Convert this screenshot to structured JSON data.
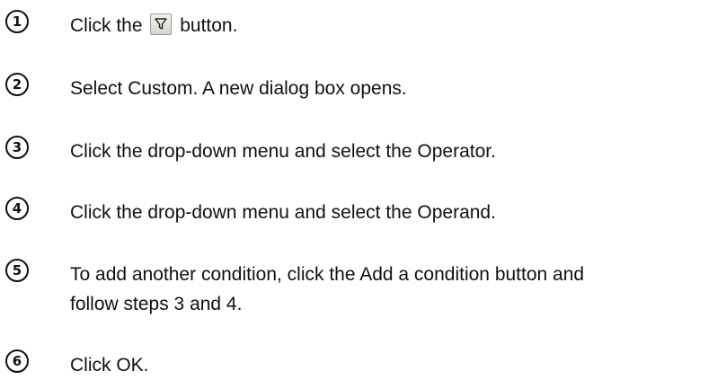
{
  "steps": [
    {
      "number": "1",
      "before": "Click the",
      "icon": "filter-icon",
      "after": "button."
    },
    {
      "number": "2",
      "text": "Select Custom. A new dialog box opens."
    },
    {
      "number": "3",
      "text": "Click the drop-down menu and select the Operator."
    },
    {
      "number": "4",
      "text": "Click the drop-down menu and select the Operand."
    },
    {
      "number": "5",
      "line1": "To add another condition, click the Add a condition button and",
      "line2": "follow steps 3 and 4."
    },
    {
      "number": "6",
      "text": "Click OK."
    }
  ]
}
